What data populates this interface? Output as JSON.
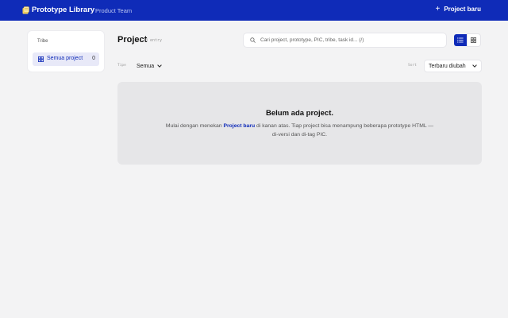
{
  "header": {
    "title": "Prototype Library",
    "separator": "·",
    "team": "Product Team",
    "new_project_label": "Project baru",
    "logo_icon": "folder-note-icon",
    "accent_color": "#0f2bb8"
  },
  "sidebar": {
    "heading": "Tribe",
    "items": [
      {
        "label": "Semua project",
        "count": "0",
        "icon": "grid-icon",
        "active": true
      }
    ]
  },
  "main": {
    "title": "Project",
    "entry_count": "0 entry",
    "search": {
      "placeholder": "Cari project, prototype, PIC, tribe, task id... (/)",
      "value": ""
    },
    "view_toggle": {
      "selected": "list",
      "options": [
        "list",
        "grid"
      ]
    },
    "filters": {
      "type_label": "Tipe",
      "type_value": "Semua",
      "sort_label": "Sort",
      "sort_value": "Terbaru diubah"
    },
    "empty_state": {
      "title": "Belum ada project.",
      "body_prefix": "Mulai dengan menekan ",
      "body_link": "Project baru",
      "body_suffix": " di kanan atas. Tiap project bisa menampung beberapa prototype HTML — di-versi dan di-tag PIC."
    }
  }
}
